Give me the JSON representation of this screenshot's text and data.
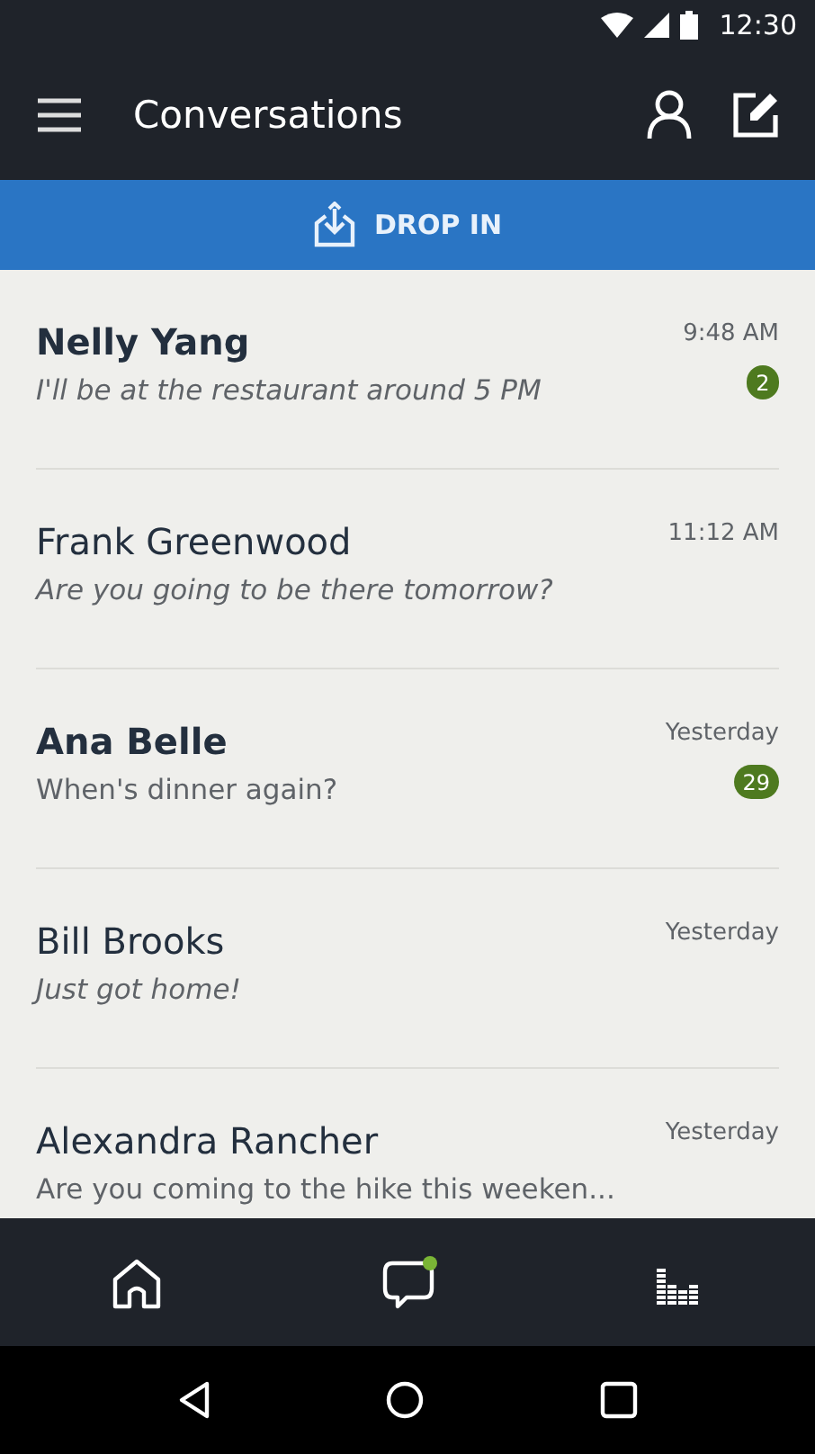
{
  "status_bar": {
    "time": "12:30"
  },
  "app_bar": {
    "title": "Conversations"
  },
  "drop_in": {
    "label": "DROP IN"
  },
  "conversations": [
    {
      "name": "Nelly Yang",
      "message": "I'll be at the restaurant around 5 PM",
      "time": "9:48 AM",
      "unread": true,
      "italic": true,
      "count": "2"
    },
    {
      "name": "Frank Greenwood",
      "message": "Are you going to be there tomorrow?",
      "time": "11:12 AM",
      "unread": false,
      "italic": true
    },
    {
      "name": "Ana Belle",
      "message": "When's dinner again?",
      "time": "Yesterday",
      "unread": true,
      "italic": false,
      "count": "29"
    },
    {
      "name": "Bill Brooks",
      "message": "Just got home!",
      "time": "Yesterday",
      "unread": false,
      "italic": true
    },
    {
      "name": "Alexandra Rancher",
      "message": "Are you coming to the hike this weeken...",
      "time": "Yesterday",
      "unread": false,
      "italic": false
    }
  ],
  "bottom_nav": [
    {
      "kind": "home",
      "notification": false
    },
    {
      "kind": "chat",
      "notification": true
    },
    {
      "kind": "activity",
      "notification": false
    }
  ]
}
